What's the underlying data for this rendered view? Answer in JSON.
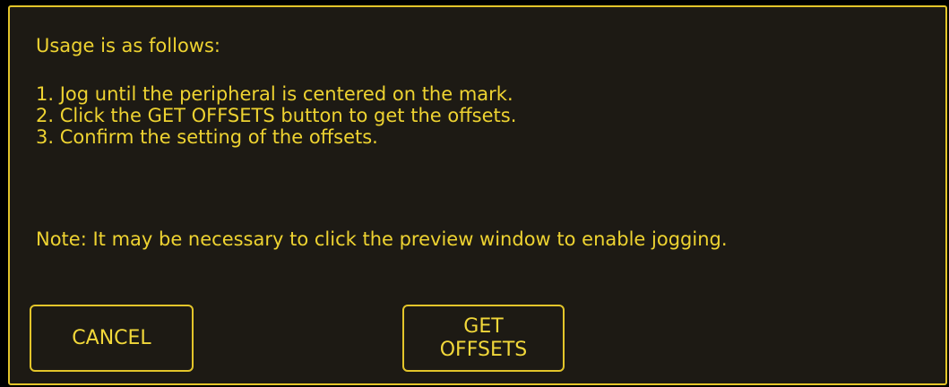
{
  "dialog": {
    "intro": "Usage is as follows:",
    "steps": [
      "1. Jog until the peripheral is centered on the mark.",
      "2. Click the GET OFFSETS button to get the offsets.",
      "3. Confirm the setting of the offsets."
    ],
    "note": "Note: It may be necessary to click the preview window to enable jogging."
  },
  "buttons": {
    "cancel_label": "CANCEL",
    "get_offsets_line1": "GET",
    "get_offsets_line2": "OFFSETS"
  },
  "colors": {
    "background": "#1d1a14",
    "text": "#eed331",
    "border": "#e3c52a"
  }
}
